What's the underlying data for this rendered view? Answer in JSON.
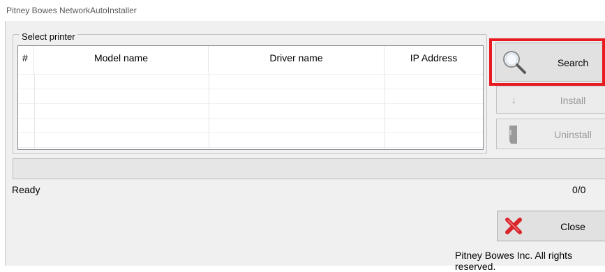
{
  "window": {
    "title": "Pitney Bowes NetworkAutoInstaller"
  },
  "group": {
    "label": "Select printer"
  },
  "table": {
    "columns": [
      "#",
      "Model name",
      "Driver name",
      "IP Address"
    ],
    "rows": []
  },
  "buttons": {
    "search": {
      "label": "Search",
      "icon": "magnifier-icon",
      "enabled": true
    },
    "install": {
      "label": "Install",
      "icon": "down-arrow-icon",
      "enabled": false
    },
    "uninstall": {
      "label": "Uninstall",
      "icon": "printer-icon",
      "enabled": false
    },
    "close": {
      "label": "Close",
      "icon": "red-x-icon",
      "enabled": true
    }
  },
  "progress": {
    "fraction": 0
  },
  "status": {
    "text": "Ready",
    "count": "0/0"
  },
  "footer": {
    "copyright": "Pitney Bowes Inc. All rights reserved."
  },
  "colors": {
    "highlight": "#e81b23",
    "close_icon": "#d9262b"
  }
}
